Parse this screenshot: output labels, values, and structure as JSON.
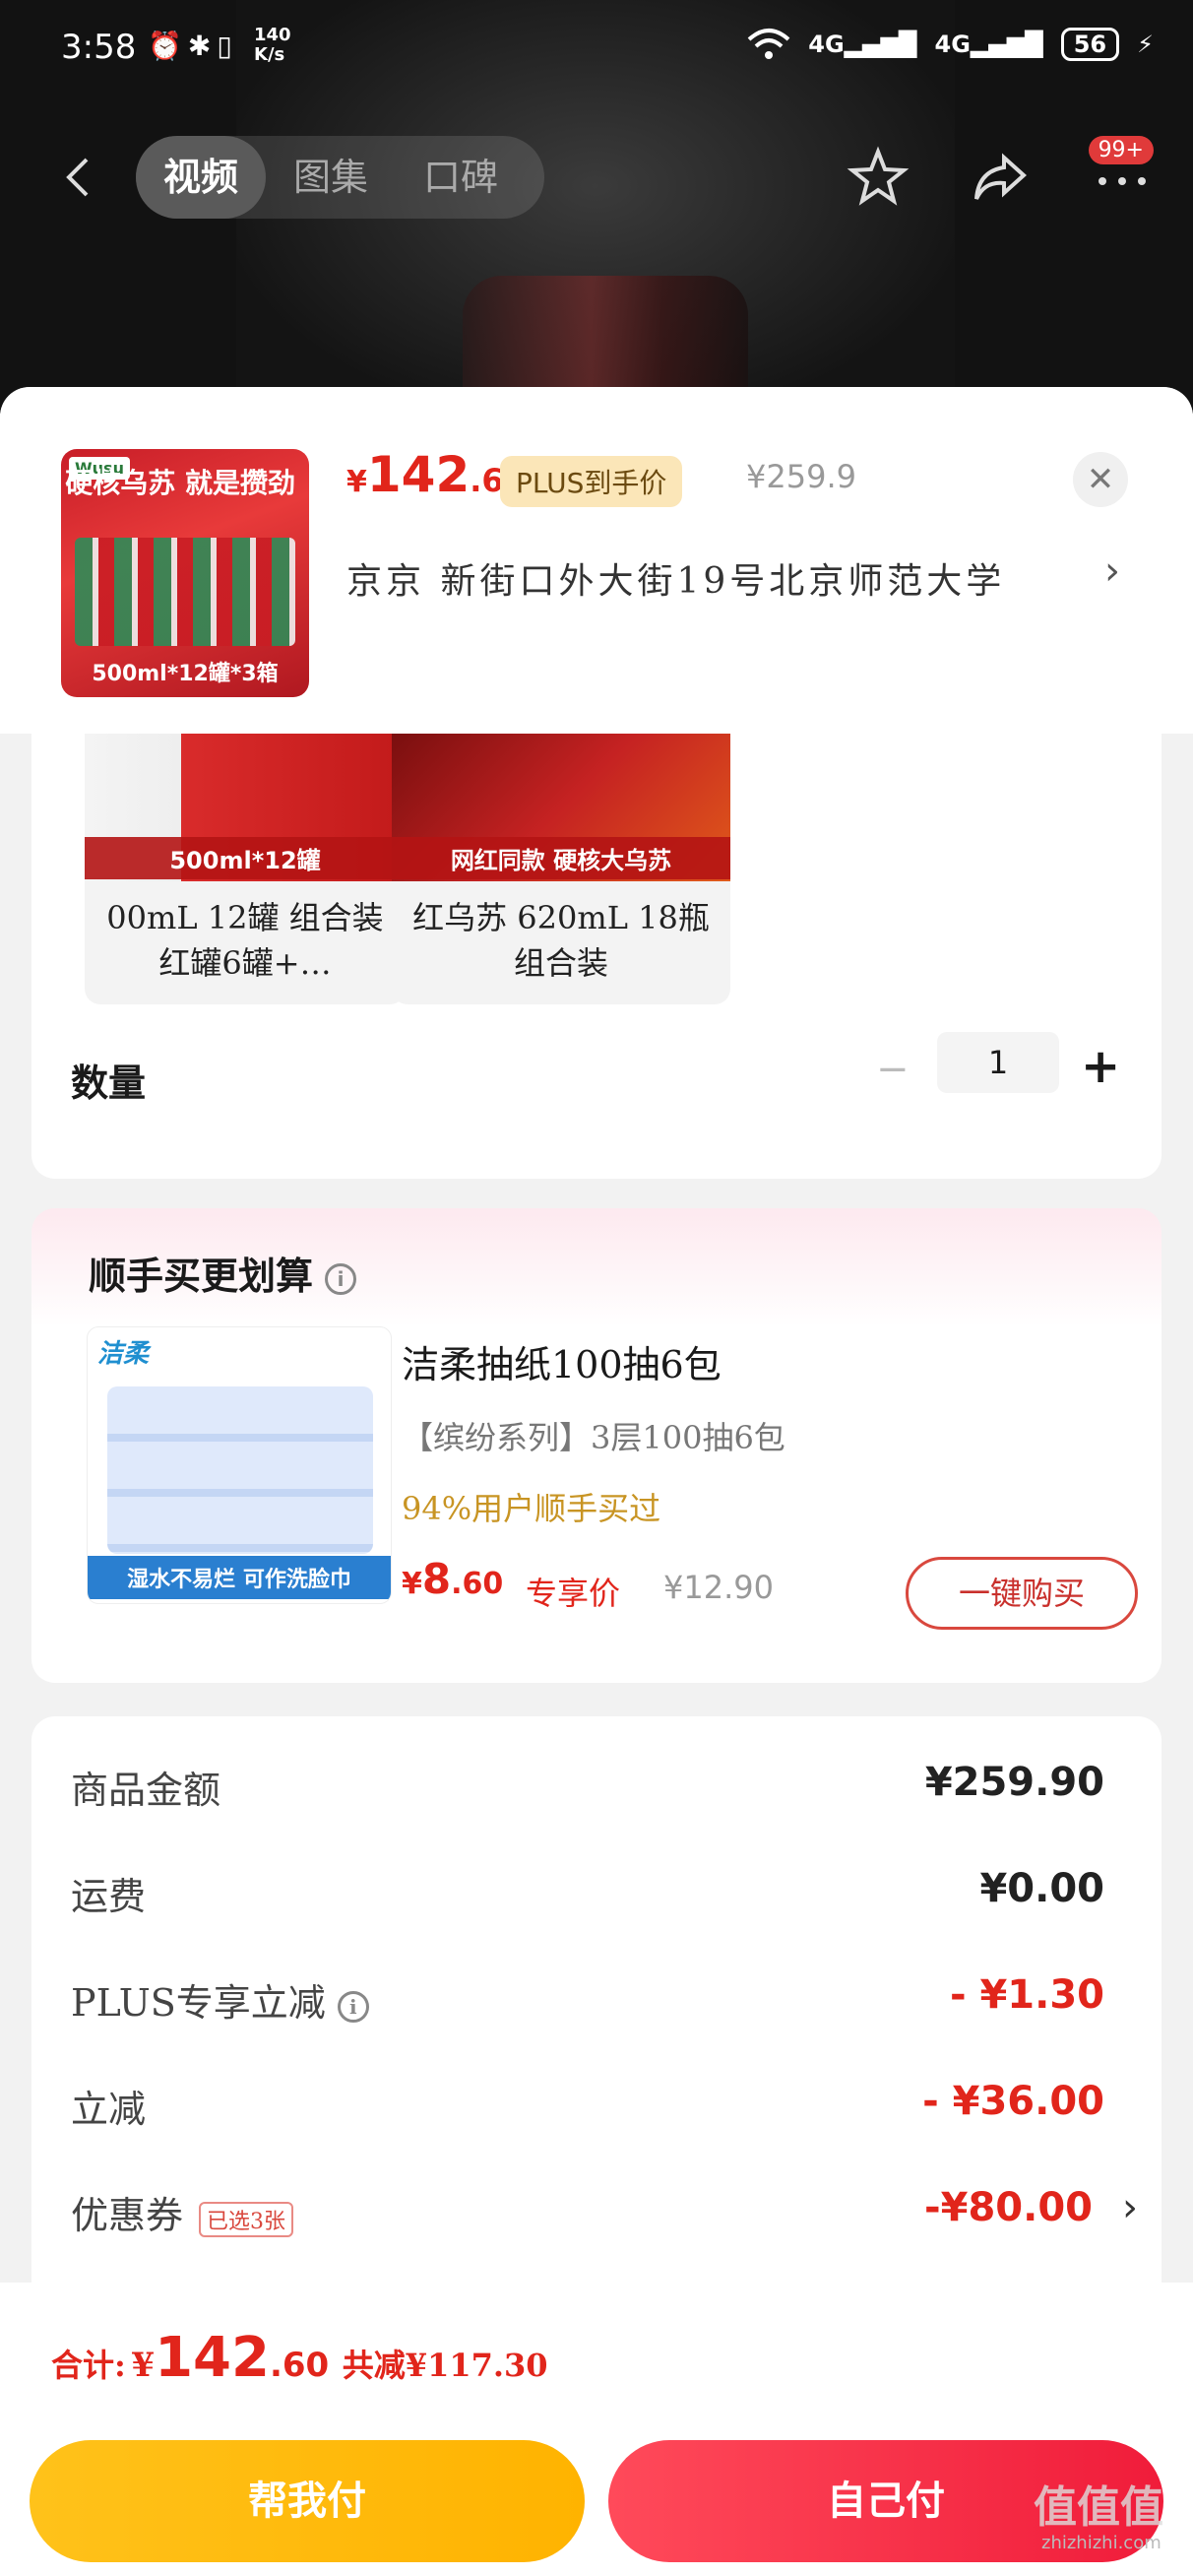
{
  "status": {
    "time": "3:58",
    "net_speed_top": "140",
    "net_speed_bottom": "K/s",
    "signal1": "4G",
    "signal2": "4G",
    "battery": "56"
  },
  "nav": {
    "tabs": [
      {
        "label": "视频",
        "active": true
      },
      {
        "label": "图集",
        "active": false
      },
      {
        "label": "口碑",
        "active": false
      }
    ],
    "badge": "99+"
  },
  "product": {
    "price_symbol": "¥",
    "price_int": "142",
    "price_dec": ".6",
    "plus_tag": "PLUS到手价",
    "original_price": "¥259.9",
    "address": "京京   新街口外大街19号北京师范大学",
    "thumb_headline": "硬核乌苏 就是攒劲",
    "thumb_logo": "Wusu",
    "thumb_size": "500ml*12罐*3箱"
  },
  "variants": [
    {
      "caption": "500ml*12罐",
      "name": "00mL 12罐 组合装 红罐6罐+…"
    },
    {
      "caption": "网红同款 硬核大乌苏",
      "name": "红乌苏 620mL 18瓶 组合装"
    }
  ],
  "quantity": {
    "label": "数量",
    "minus": "−",
    "value": "1",
    "plus": "+"
  },
  "addon": {
    "title": "顺手买更划算",
    "brand": "洁柔",
    "banner": "湿水不易烂 可作洗脸巾",
    "name": "洁柔抽纸100抽6包",
    "spec": "【缤纷系列】3层100抽6包",
    "percent": "94%用户顺手买过",
    "price_symbol": "¥",
    "price_int": "8",
    "price_dec": ".60",
    "exclusive": "专享价",
    "original": "¥12.90",
    "button": "一键购买"
  },
  "summary": {
    "rows": [
      {
        "label": "商品金额",
        "value": "¥259.90"
      },
      {
        "label": "运费",
        "value": "¥0.00"
      },
      {
        "label": "PLUS专享立减",
        "value": "- ¥1.30"
      },
      {
        "label": "立减",
        "value": "- ¥36.00"
      },
      {
        "label": "优惠券",
        "tag": "已选3张",
        "value": "-¥80.00"
      }
    ]
  },
  "bottom": {
    "total_label": "合计:",
    "total_symbol": "¥",
    "total_int": "142",
    "total_dec": ".60",
    "saved": "共减¥117.30",
    "help_pay": "帮我付",
    "self_pay": "自己付"
  },
  "watermark": {
    "text": "值值值",
    "sub": "zhizhizhi.com"
  }
}
